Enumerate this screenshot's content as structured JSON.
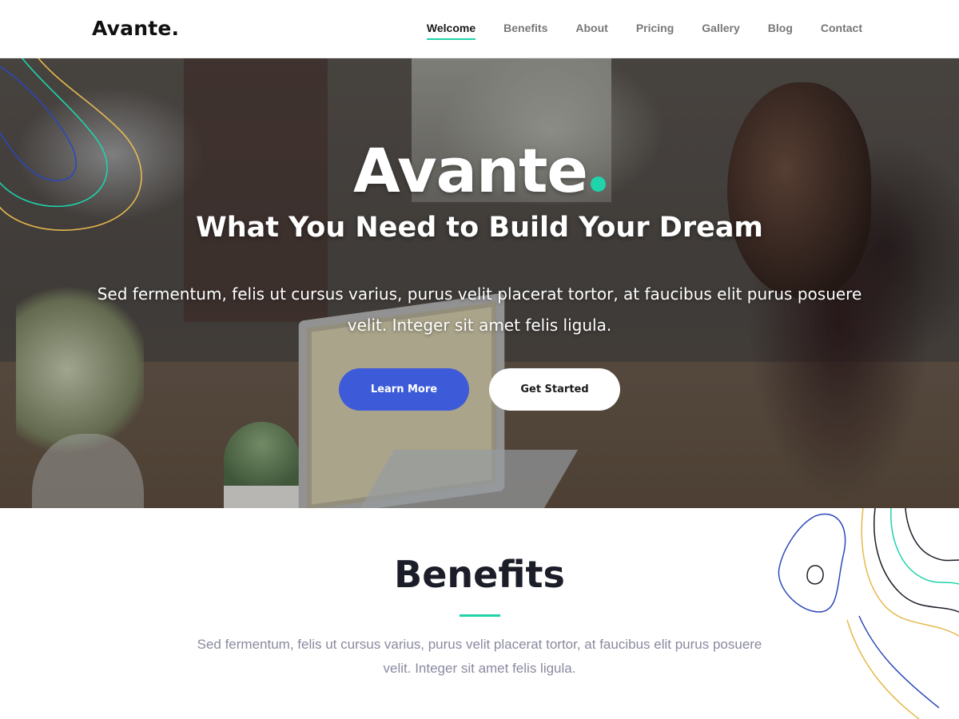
{
  "brand": {
    "logo": "Avante."
  },
  "nav": {
    "items": [
      {
        "label": "Welcome",
        "active": true
      },
      {
        "label": "Benefits",
        "active": false
      },
      {
        "label": "About",
        "active": false
      },
      {
        "label": "Pricing",
        "active": false
      },
      {
        "label": "Gallery",
        "active": false
      },
      {
        "label": "Blog",
        "active": false
      },
      {
        "label": "Contact",
        "active": false
      }
    ]
  },
  "hero": {
    "title": "Avante",
    "subtitle": "What You Need to Build Your Dream",
    "description": "Sed fermentum, felis ut cursus varius, purus velit placerat tortor, at faucibus elit purus posuere velit. Integer sit amet felis ligula.",
    "primary_button": "Learn More",
    "secondary_button": "Get Started"
  },
  "benefits": {
    "title": "Benefits",
    "description": "Sed fermentum, felis ut cursus varius, purus velit placerat tortor, at faucibus elit purus posuere velit. Integer sit amet felis ligula."
  },
  "colors": {
    "accent": "#1fd3ab",
    "primary_button": "#3d5bd9",
    "heading_dark": "#1b1e29",
    "muted_text": "#8a8aa0"
  }
}
